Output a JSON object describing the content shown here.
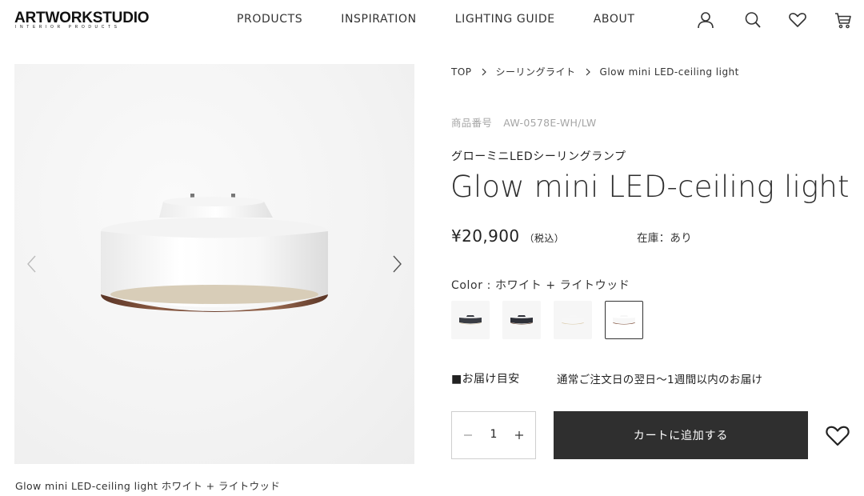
{
  "brand": {
    "name": "ARTWORKSTUDIO",
    "tagline": "INTERIOR PRODUCTS"
  },
  "nav": {
    "items": [
      {
        "label": "PRODUCTS"
      },
      {
        "label": "INSPIRATION"
      },
      {
        "label": "LIGHTING GUIDE"
      },
      {
        "label": "ABOUT"
      }
    ]
  },
  "header_icons": [
    "account-icon",
    "search-icon",
    "heart-icon",
    "cart-icon"
  ],
  "gallery": {
    "caption": "Glow mini LED-ceiling light ホワイト + ライトウッド"
  },
  "breadcrumb": [
    {
      "label": "TOP"
    },
    {
      "label": "シーリングライト"
    },
    {
      "label": "Glow mini LED-ceiling light"
    }
  ],
  "product": {
    "sku_label": "商品番号",
    "sku": "AW-0578E-WH/LW",
    "name_jp": "グローミニLEDシーリングランプ",
    "title": "Glow mini LED-ceiling light",
    "price": "¥20,900",
    "tax_note": "（税込）",
    "stock": "在庫：あり",
    "color_label": "Color : ホワイト + ライトウッド",
    "swatches": [
      {
        "body": "#3a3d44",
        "rim": "#d9c9a8"
      },
      {
        "body": "#2e3038",
        "rim": "#6b4a36"
      },
      {
        "body": "#f7f7f7",
        "rim": "#d9c9a8"
      },
      {
        "body": "#f7f7f7",
        "rim": "#7a4a34"
      }
    ],
    "selected_swatch": 3,
    "delivery_label": "■お届け目安",
    "delivery_text": "通常ご注文日の翌日〜1週間以内のお届け",
    "quantity": "1",
    "add_to_cart": "カートに追加する"
  },
  "colors": {
    "button_bg": "#2f2f2f",
    "text_muted": "#a5a5a5"
  }
}
